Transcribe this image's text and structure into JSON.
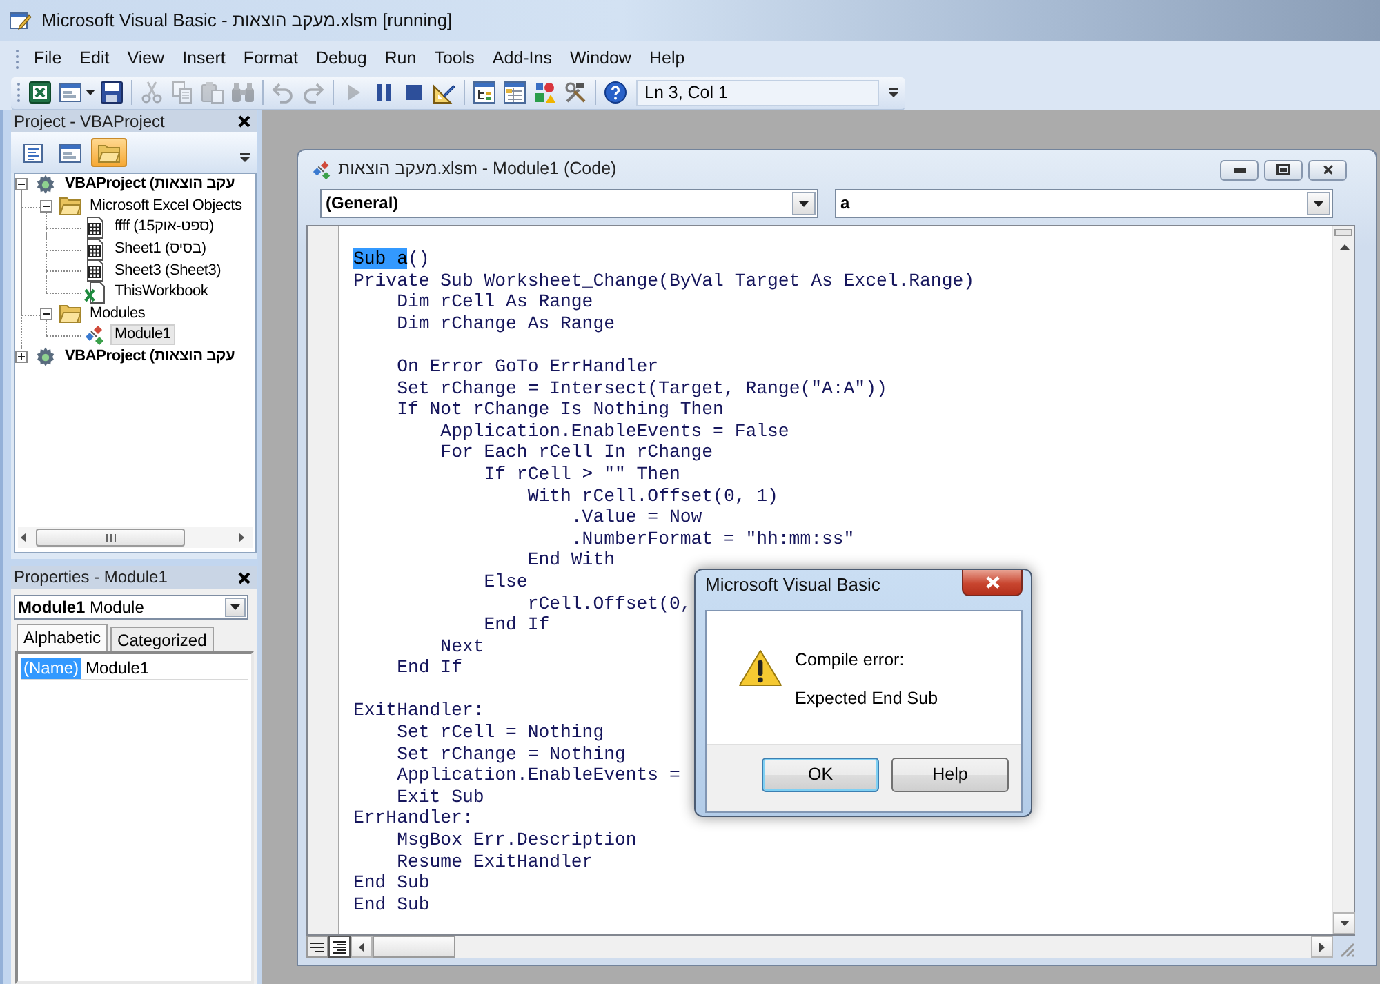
{
  "window": {
    "title": "Microsoft Visual Basic - מעקב הוצאות.xlsm [running]"
  },
  "menu": [
    "File",
    "Edit",
    "View",
    "Insert",
    "Format",
    "Debug",
    "Run",
    "Tools",
    "Add-Ins",
    "Window",
    "Help"
  ],
  "toolbar": {
    "tools": [
      {
        "kind": "view-excel",
        "disabled": false
      },
      {
        "kind": "insert-userform",
        "disabled": false
      },
      {
        "kind": "save",
        "disabled": false
      },
      {
        "kind": "separator"
      },
      {
        "kind": "cut",
        "disabled": true
      },
      {
        "kind": "copy",
        "disabled": true
      },
      {
        "kind": "paste",
        "disabled": true
      },
      {
        "kind": "find",
        "disabled": true
      },
      {
        "kind": "separator"
      },
      {
        "kind": "undo",
        "disabled": true
      },
      {
        "kind": "redo",
        "disabled": true
      },
      {
        "kind": "separator"
      },
      {
        "kind": "run",
        "disabled": true
      },
      {
        "kind": "break",
        "disabled": false
      },
      {
        "kind": "reset",
        "disabled": false
      },
      {
        "kind": "design-mode",
        "disabled": false
      },
      {
        "kind": "separator"
      },
      {
        "kind": "project-explorer",
        "disabled": false
      },
      {
        "kind": "properties-window",
        "disabled": false
      },
      {
        "kind": "object-browser",
        "disabled": false
      },
      {
        "kind": "toolbox",
        "disabled": false
      },
      {
        "kind": "separator"
      },
      {
        "kind": "help",
        "disabled": false
      }
    ],
    "position": "Ln 3, Col 1"
  },
  "project_pane": {
    "title": "Project - VBAProject",
    "toolbar": [
      {
        "kind": "view-code",
        "on": false
      },
      {
        "kind": "view-object",
        "on": false
      },
      {
        "kind": "toggle-folders",
        "on": true
      }
    ],
    "tree": [
      {
        "label": "VBAProject (עקב הוצאות",
        "kind": "project",
        "expanded": true,
        "selected": false,
        "children": [
          {
            "label": "Microsoft Excel Objects",
            "kind": "folder",
            "expanded": true,
            "selected": false,
            "children": [
              {
                "label": "ffff (ספט-אוק15)",
                "kind": "sheet",
                "selected": false
              },
              {
                "label": "Sheet1 (בסיס)",
                "kind": "sheet",
                "selected": false
              },
              {
                "label": "Sheet3 (Sheet3)",
                "kind": "sheet",
                "selected": false
              },
              {
                "label": "ThisWorkbook",
                "kind": "workbook",
                "selected": false
              }
            ]
          },
          {
            "label": "Modules",
            "kind": "folder",
            "expanded": true,
            "selected": false,
            "children": [
              {
                "label": "Module1",
                "kind": "module",
                "selected": true
              }
            ]
          }
        ]
      },
      {
        "label": "VBAProject (עקב הוצאות",
        "kind": "project",
        "expanded": false,
        "selected": false
      }
    ]
  },
  "properties_pane": {
    "title": "Properties - Module1",
    "object_selector": "**Module1** Module",
    "tabs": [
      {
        "label": "Alphabetic",
        "selected": true
      },
      {
        "label": "Categorized",
        "selected": false
      }
    ],
    "rows": [
      {
        "property": "(Name)",
        "value": "Module1",
        "selected": true
      }
    ]
  },
  "code_window": {
    "title": "מעקב הוצאות.xlsm - Module1 (Code)",
    "object_dropdown": "(General)",
    "procedure_dropdown": "a",
    "lines": [
      {
        "kind": "code",
        "segments": [
          {
            "text": "Sub a",
            "selected": true
          },
          {
            "text": "()",
            "selected": false
          }
        ]
      },
      {
        "kind": "code",
        "segments": [
          {
            "text": "Private Sub Worksheet_Change(ByVal Target As Excel.Range)",
            "selected": false
          }
        ]
      },
      {
        "kind": "code",
        "segments": [
          {
            "text": "    Dim rCell As Range",
            "selected": false
          }
        ]
      },
      {
        "kind": "code",
        "segments": [
          {
            "text": "    Dim rChange As Range",
            "selected": false
          }
        ]
      },
      {
        "kind": "blank"
      },
      {
        "kind": "code",
        "segments": [
          {
            "text": "    On Error GoTo ErrHandler",
            "selected": false
          }
        ]
      },
      {
        "kind": "code",
        "segments": [
          {
            "text": "    Set rChange = Intersect(Target, Range(\"A:A\"))",
            "selected": false
          }
        ]
      },
      {
        "kind": "code",
        "segments": [
          {
            "text": "    If Not rChange Is Nothing Then",
            "selected": false
          }
        ]
      },
      {
        "kind": "code",
        "segments": [
          {
            "text": "        Application.EnableEvents = False",
            "selected": false
          }
        ]
      },
      {
        "kind": "code",
        "segments": [
          {
            "text": "        For Each rCell In rChange",
            "selected": false
          }
        ]
      },
      {
        "kind": "code",
        "segments": [
          {
            "text": "            If rCell > \"\" Then",
            "selected": false
          }
        ]
      },
      {
        "kind": "code",
        "segments": [
          {
            "text": "                With rCell.Offset(0, 1)",
            "selected": false
          }
        ]
      },
      {
        "kind": "code",
        "segments": [
          {
            "text": "                    .Value = Now",
            "selected": false
          }
        ]
      },
      {
        "kind": "code",
        "segments": [
          {
            "text": "                    .NumberFormat = \"hh:mm:ss\"",
            "selected": false
          }
        ]
      },
      {
        "kind": "code",
        "segments": [
          {
            "text": "                End With",
            "selected": false
          }
        ]
      },
      {
        "kind": "code",
        "segments": [
          {
            "text": "            Else",
            "selected": false
          }
        ]
      },
      {
        "kind": "code",
        "segments": [
          {
            "text": "                rCell.Offset(0,",
            "selected": false
          }
        ]
      },
      {
        "kind": "code",
        "segments": [
          {
            "text": "            End If",
            "selected": false
          }
        ]
      },
      {
        "kind": "code",
        "segments": [
          {
            "text": "        Next",
            "selected": false
          }
        ]
      },
      {
        "kind": "code",
        "segments": [
          {
            "text": "    End If",
            "selected": false
          }
        ]
      },
      {
        "kind": "blank"
      },
      {
        "kind": "code",
        "segments": [
          {
            "text": "ExitHandler:",
            "selected": false
          }
        ]
      },
      {
        "kind": "code",
        "segments": [
          {
            "text": "    Set rCell = Nothing",
            "selected": false
          }
        ]
      },
      {
        "kind": "code",
        "segments": [
          {
            "text": "    Set rChange = Nothing",
            "selected": false
          }
        ]
      },
      {
        "kind": "code",
        "segments": [
          {
            "text": "    Application.EnableEvents =",
            "selected": false
          }
        ]
      },
      {
        "kind": "code",
        "segments": [
          {
            "text": "    Exit Sub",
            "selected": false
          }
        ]
      },
      {
        "kind": "code",
        "segments": [
          {
            "text": "ErrHandler:",
            "selected": false
          }
        ]
      },
      {
        "kind": "code",
        "segments": [
          {
            "text": "    MsgBox Err.Description",
            "selected": false
          }
        ]
      },
      {
        "kind": "code",
        "segments": [
          {
            "text": "    Resume ExitHandler",
            "selected": false
          }
        ]
      },
      {
        "kind": "code",
        "segments": [
          {
            "text": "End Sub",
            "selected": false
          }
        ]
      },
      {
        "kind": "code",
        "segments": [
          {
            "text": "End Sub",
            "selected": false
          }
        ]
      }
    ],
    "view_buttons": [
      {
        "kind": "procedure-view",
        "selected": false
      },
      {
        "kind": "full-module-view",
        "selected": true
      }
    ]
  },
  "dialog": {
    "title": "Microsoft Visual Basic",
    "messages": [
      "Compile error:",
      "Expected End Sub"
    ],
    "buttons": [
      {
        "label": "OK",
        "default": true
      },
      {
        "label": "Help",
        "default": false
      }
    ]
  }
}
